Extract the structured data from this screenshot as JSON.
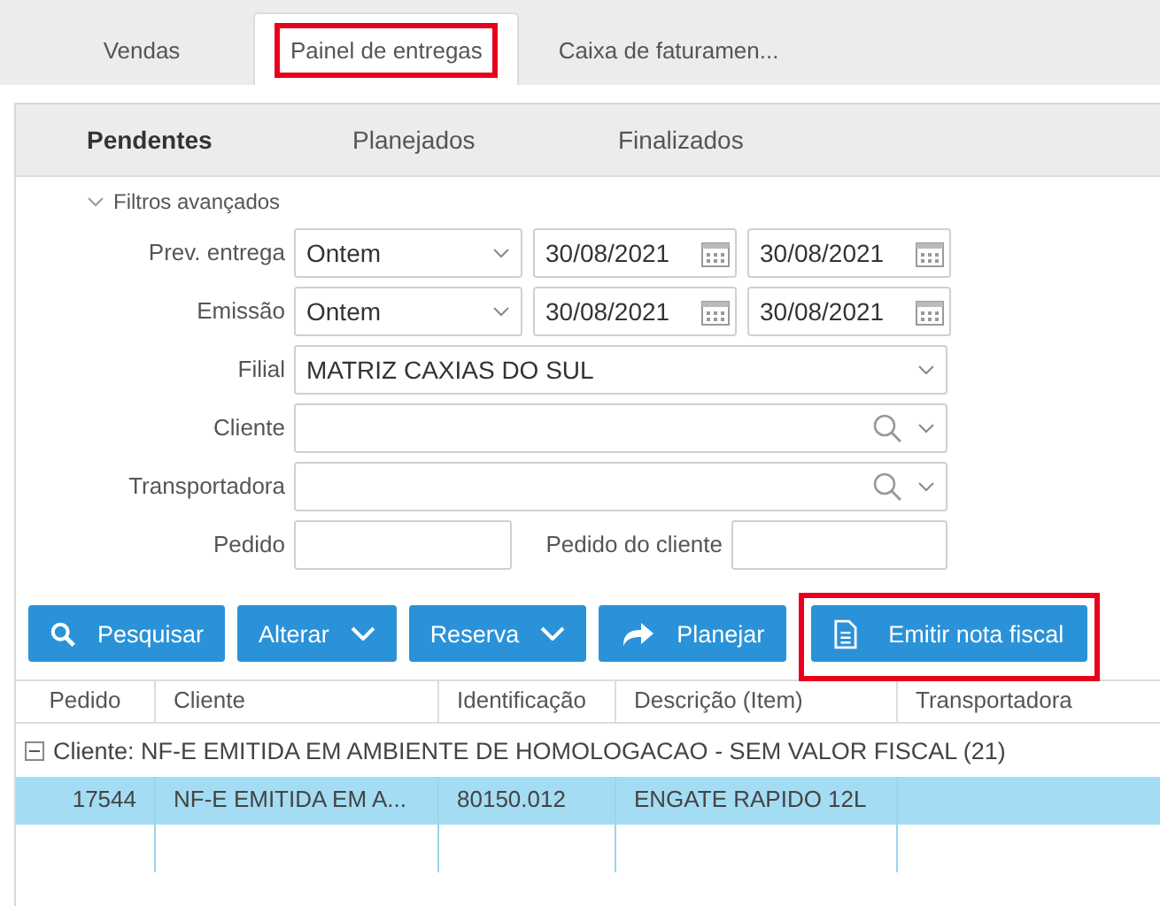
{
  "tabs": [
    {
      "label": "Vendas",
      "selected": false,
      "highlighted": false
    },
    {
      "label": "Painel de entregas",
      "selected": true,
      "highlighted": true
    },
    {
      "label": "Caixa de faturamen...",
      "selected": false,
      "highlighted": false
    }
  ],
  "subtabs": [
    {
      "label": "Pendentes",
      "selected": true
    },
    {
      "label": "Planejados",
      "selected": false
    },
    {
      "label": "Finalizados",
      "selected": false
    }
  ],
  "filters": {
    "title": "Filtros avançados",
    "expanded": true,
    "rows": [
      {
        "kind": "period",
        "label": "Prev. entrega",
        "value": "Ontem",
        "from": "30/08/2021",
        "to": "30/08/2021"
      },
      {
        "kind": "period",
        "label": "Emissão",
        "value": "Ontem",
        "from": "30/08/2021",
        "to": "30/08/2021"
      },
      {
        "kind": "select",
        "label": "Filial",
        "value": "MATRIZ CAXIAS DO SUL"
      },
      {
        "kind": "lookup",
        "label": "Cliente"
      },
      {
        "kind": "lookup",
        "label": "Transportadora"
      },
      {
        "kind": "pair",
        "label": "Pedido",
        "label2": "Pedido do cliente"
      }
    ]
  },
  "buttons": [
    {
      "label": "Pesquisar",
      "dropdown": false,
      "highlighted": false
    },
    {
      "label": "Alterar",
      "dropdown": true,
      "highlighted": false
    },
    {
      "label": "Reserva",
      "dropdown": true,
      "highlighted": false
    },
    {
      "label": "Planejar",
      "dropdown": false,
      "highlighted": false
    },
    {
      "label": "Emitir nota fiscal",
      "dropdown": false,
      "highlighted": true
    }
  ],
  "table": {
    "columns": [
      "Pedido",
      "Cliente",
      "Identificação",
      "Descrição (Item)",
      "Transportadora"
    ],
    "group": {
      "label": "Cliente: NF-E EMITIDA EM AMBIENTE DE HOMOLOGACAO - SEM VALOR FISCAL (21)",
      "expanded": true
    },
    "rows": [
      {
        "cells": [
          "17544",
          "NF-E EMITIDA EM A...",
          "80150.012",
          "ENGATE RAPIDO 12L",
          ""
        ],
        "selected": true
      }
    ]
  }
}
